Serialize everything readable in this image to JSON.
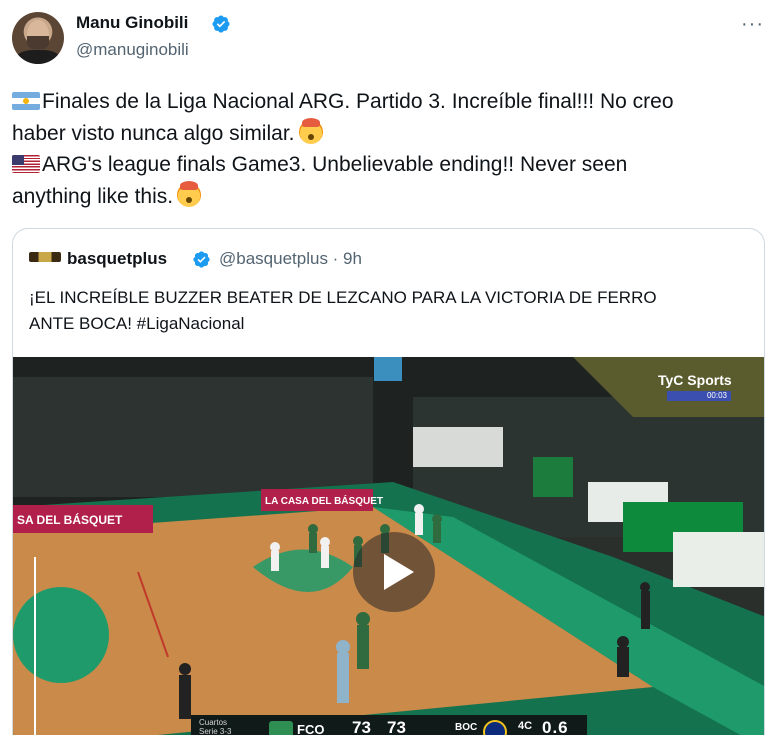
{
  "author": {
    "name": "Manu Ginobili",
    "handle": "@manuginobili",
    "more_label": "···"
  },
  "tweet": {
    "line1": "Finales de la Liga Nacional ARG. Partido 3. Increíble final!!! No creo",
    "line2": "haber visto nunca algo similar.",
    "line3": "ARG's league finals Game3. Unbelievable ending!! Never seen",
    "line4": "anything like this.",
    "flag_ar": "argentina-flag-icon",
    "flag_us": "usa-flag-icon",
    "emoji": "exploding-head-icon"
  },
  "quoted": {
    "name": "basquetplus",
    "handle_time": "@basquetplus · 9h",
    "text_line1": "¡EL INCREÍBLE BUZZER BEATER DE LEZCANO PARA LA VICTORIA DE FERRO",
    "text_line2": "ANTE BOCA! #LigaNacional"
  },
  "video": {
    "broadcaster": "TyC Sports",
    "broadcast_clock": "00:03",
    "banner_left": "SA DEL BÁSQUET",
    "banner_mid": "LA CASA DEL BÁSQUET",
    "scoreboard": {
      "round": "Cuartos",
      "round_sub": "Serie 3-3",
      "home": "FCO",
      "home_score": "73",
      "away_score": "73",
      "away": "BOC",
      "quarter": "4C",
      "clock": "0.6"
    }
  },
  "colors": {
    "verified": "#1d9bf0",
    "text": "#0f1419",
    "muted": "#536471",
    "border": "#cfd9de",
    "court": "#c98a4a",
    "court_green": "#1f9b6b"
  }
}
